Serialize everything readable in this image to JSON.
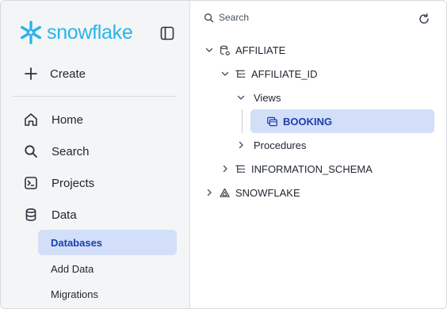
{
  "sidebar": {
    "logo_text": "snowflake",
    "create_label": "Create",
    "nav": [
      {
        "label": "Home",
        "icon": "home-icon"
      },
      {
        "label": "Search",
        "icon": "search-icon"
      },
      {
        "label": "Projects",
        "icon": "projects-icon"
      },
      {
        "label": "Data",
        "icon": "database-icon"
      }
    ],
    "data_sub": [
      {
        "label": "Databases",
        "active": true
      },
      {
        "label": "Add Data",
        "active": false
      },
      {
        "label": "Migrations",
        "active": false
      }
    ]
  },
  "explorer": {
    "search_placeholder": "Search",
    "tree": {
      "db1": "AFFILIATE",
      "schema1": "AFFILIATE_ID",
      "views": "Views",
      "view1": "BOOKING",
      "procedures": "Procedures",
      "schema2": "INFORMATION_SCHEMA",
      "db2": "SNOWFLAKE"
    }
  },
  "colors": {
    "brand": "#29b5e8",
    "active_bg": "#d3dff8",
    "active_text": "#1a3fb0"
  }
}
